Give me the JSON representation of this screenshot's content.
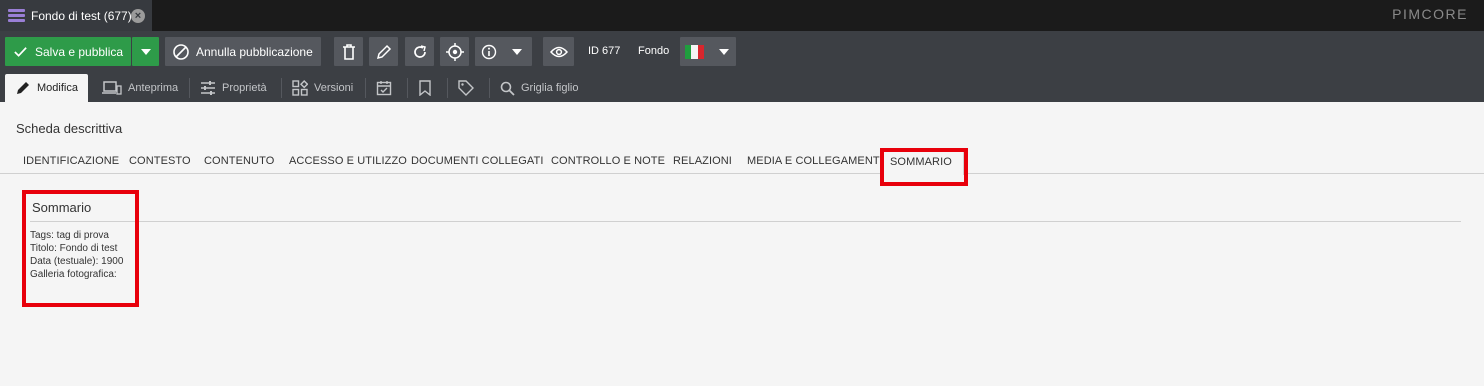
{
  "tabbar": {
    "tab_title": "Fondo di test (677)",
    "tab_icon": "object-list-icon",
    "close_glyph": "×",
    "brand": "PIMCORE"
  },
  "toolbar": {
    "save_label": "Salva e pubblica",
    "unpublish_label": "Annulla pubblicazione",
    "id_label": "ID 677",
    "class_label": "Fondo",
    "language_flag": "italy-flag-icon",
    "colors": {
      "save": "#2e9b49",
      "button": "#55585e",
      "bar": "#3c3f44"
    }
  },
  "subtabs": {
    "items": [
      {
        "label": "Modifica",
        "icon": "pencil-icon",
        "active": true
      },
      {
        "label": "Anteprima",
        "icon": "devices-icon"
      },
      {
        "label": "Proprietà",
        "icon": "sliders-icon"
      },
      {
        "label": "Versioni",
        "icon": "widgets-icon"
      },
      {
        "label": "",
        "icon": "calendar-check-icon"
      },
      {
        "label": "",
        "icon": "bookmark-icon"
      },
      {
        "label": "",
        "icon": "tag-icon"
      },
      {
        "label": "Griglia figlio",
        "icon": "search-icon"
      }
    ]
  },
  "panel": {
    "title": "Scheda descrittiva",
    "tabs": [
      "IDENTIFICAZIONE",
      "CONTESTO",
      "CONTENUTO",
      "ACCESSO E UTILIZZO",
      "DOCUMENTI COLLEGATI",
      "CONTROLLO E NOTE",
      "RELAZIONI",
      "MEDIA E COLLEGAMENTI",
      "SOMMARIO"
    ],
    "active_tab": "SOMMARIO"
  },
  "summary": {
    "title": "Sommario",
    "lines": [
      "Tags: tag di prova",
      "Titolo: Fondo di test",
      "Data (testuale): 1900",
      "Galleria fotografica:"
    ]
  },
  "highlight_color": "#e8000b"
}
